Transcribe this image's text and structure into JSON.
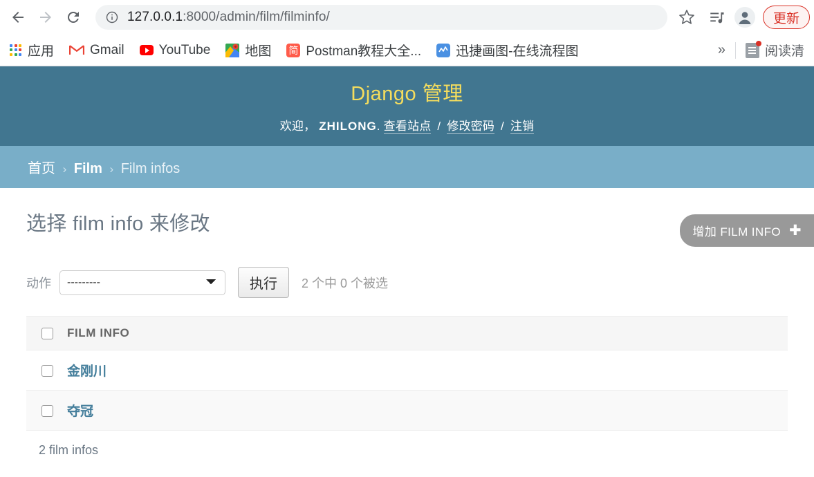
{
  "browser": {
    "nav": {
      "back_title": "Back",
      "forward_title": "Forward",
      "reload_title": "Reload"
    },
    "url_host": "127.0.0.1",
    "url_path": ":8000/admin/film/filminfo/",
    "url_full": "127.0.0.1:8000/admin/film/filminfo/",
    "star_title": "Bookmark this tab",
    "media_title": "Media controls",
    "profile_title": "Profile",
    "update_label": "更新",
    "bookmarks": [
      {
        "label": "应用",
        "icon": "apps-grid-icon"
      },
      {
        "label": "Gmail",
        "icon": "gmail-icon"
      },
      {
        "label": "YouTube",
        "icon": "youtube-icon"
      },
      {
        "label": "地图",
        "icon": "google-maps-icon"
      },
      {
        "label": "Postman教程大全...",
        "icon": "jianshu-icon"
      },
      {
        "label": "迅捷画图-在线流程图",
        "icon": "xunjie-icon"
      }
    ],
    "overflow_label": "»",
    "reading_list_label": "阅读清"
  },
  "django": {
    "site_title": "Django 管理",
    "welcome_prefix": "欢迎，",
    "username": "ZHILONG",
    "welcome_suffix": ".",
    "user_links": [
      {
        "label": "查看站点"
      },
      {
        "label": "修改密码"
      },
      {
        "label": "注销"
      }
    ],
    "link_sep": "/",
    "breadcrumbs": [
      {
        "label": "首页",
        "link": true,
        "bold": false
      },
      {
        "label": "Film",
        "link": true,
        "bold": true
      },
      {
        "label": "Film infos",
        "link": false,
        "bold": false
      }
    ],
    "breadcrumb_sep": "›",
    "page_title": "选择 film info 来修改",
    "add_button_label": "增加 FILM INFO",
    "add_button_plus": "✚",
    "actions": {
      "label": "动作",
      "selected_option": "---------",
      "options": [
        "---------"
      ],
      "run_label": "执行",
      "counter": "2 个中 0 个被选"
    },
    "table": {
      "columns": [
        "FILM INFO"
      ],
      "rows": [
        {
          "name": "金刚川"
        },
        {
          "name": "夺冠"
        }
      ]
    },
    "paginator": "2 film infos",
    "colors": {
      "header_bg": "#417690",
      "breadcrumb_bg": "#79aec8",
      "branding": "#f5dd5d",
      "link": "#447e9b",
      "add_button_bg": "#999999"
    }
  }
}
